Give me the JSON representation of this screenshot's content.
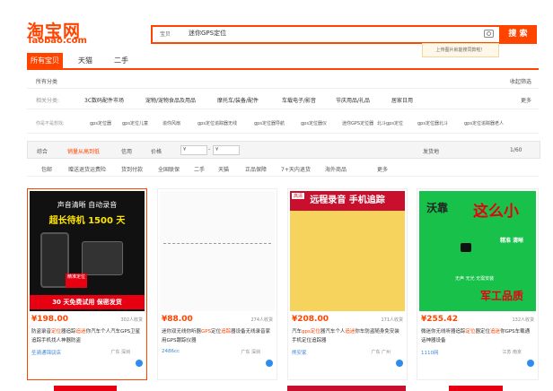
{
  "logo": {
    "cn": "淘宝网",
    "en": "Taobao.com"
  },
  "search": {
    "type": "宝贝",
    "query": "迷你GPS定位",
    "button": "搜 索",
    "tip": "上传图片就能搜同款啦！"
  },
  "tabs": [
    "所有宝贝",
    "天猫",
    "二手"
  ],
  "all_categories": "所有分类",
  "collapse_filter": "收起筛选",
  "category_row": {
    "label": "相关分类:",
    "items": [
      "3C数码配件市场",
      "宠物/宠物食品及用品",
      "摩托车/装备/配件",
      "车载电子/影音",
      "节庆用品/礼品",
      "居家日用"
    ],
    "more": "更多"
  },
  "suggest_row": {
    "label": "你是不是想找:",
    "items": [
      "gps定位器",
      "gps定位儿童",
      "追你风扇",
      "gps定位追踪器无线",
      "gps定位器导航",
      "gps定位器仪",
      "迷你GPS定位器",
      "北斗gps定位",
      "gps定位器北斗",
      "gps定位追踪器老人"
    ]
  },
  "sort_row": {
    "items": [
      "综合",
      "销量从高到低",
      "信用",
      "价格"
    ],
    "price_from": "¥",
    "price_to": "¥",
    "ship_from": "发货地",
    "page": "1/60"
  },
  "filter_row": {
    "items": [
      "包邮",
      "赠送退货运费险",
      "货到付款",
      "全国联保",
      "二手",
      "天猫",
      "正品保障",
      "7+天内退货",
      "海外商品"
    ],
    "more": "更多"
  },
  "products": [
    {
      "price": "¥198.00",
      "sold": "302人收货",
      "title_pre": "防盗录音",
      "hl1": "定位",
      "title_mid": "器追踪",
      "hl2": "追迷",
      "title_rest": "你汽车个人汽车GPS卫星追踪手机找人神器防盗",
      "shop": "圣骑通锦驭店",
      "loc": "广东 深圳",
      "img": {
        "line1": "声音清晰 自动录音",
        "line2": "超长待机 1500 天",
        "badge": "精准定位",
        "banner": "30 天免费试用 保密发货"
      }
    },
    {
      "price": "¥88.00",
      "sold": "274人收货",
      "title_pre": "迷你双无线你听器",
      "hl1": "GPS",
      "title_mid": "定位",
      "hl2": "追踪",
      "title_rest": "器设备无线录音家用GPS跟踪仪器",
      "shop": "2486cc",
      "loc": "广东 深圳",
      "img": {}
    },
    {
      "price": "¥208.00",
      "sold": "171人收货",
      "title_pre": "汽车",
      "hl1": "gps定位",
      "title_mid": "器汽车个人",
      "hl2": "追迷",
      "title_rest": "你车防盗随身免安装手机定位追踪器",
      "shop": "熊安家",
      "loc": "广东 广州",
      "img": {
        "line1": "远程录音 手机追踪",
        "tag": "高清"
      }
    },
    {
      "price": "¥255.42",
      "sold": "132人收货",
      "title_pre": "微迷你无线听器追踪",
      "hl1": "定位",
      "title_mid": "器定位",
      "hl2": "追迷",
      "title_rest": "你GPS车载通话神器设备",
      "shop": "1110网",
      "loc": "江苏 南京",
      "img": {
        "line1": "沃靠",
        "line2": "这么小",
        "line3": "精准 清晰",
        "line4": "无声 无光 无需安装",
        "line5": "军工品质"
      }
    }
  ],
  "colors": {
    "accent": "#ff4400",
    "link": "#3f88d6"
  }
}
